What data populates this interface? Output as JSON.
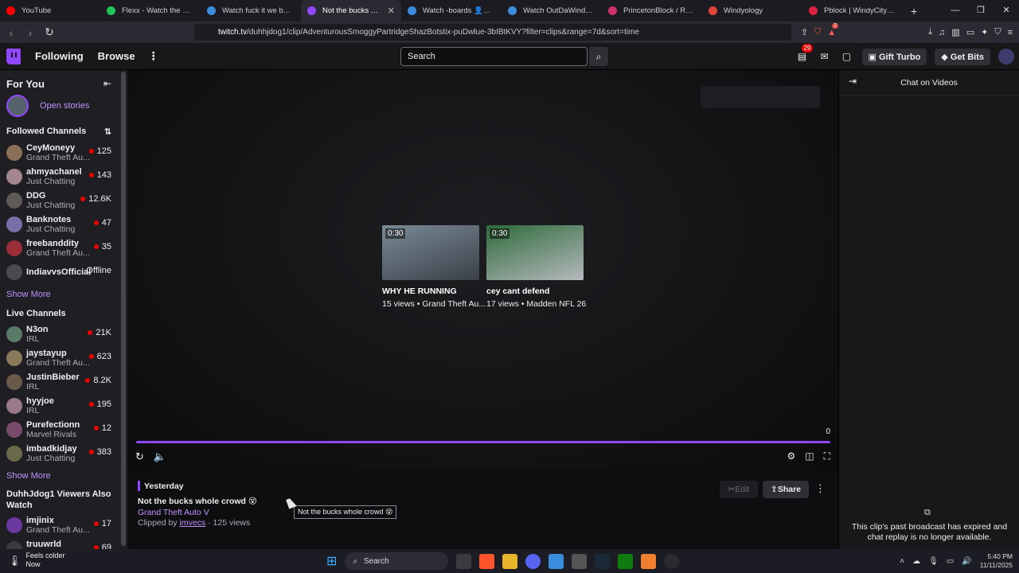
{
  "browser": {
    "tabs": [
      {
        "label": "YouTube",
        "color": "#ff0000",
        "active": false
      },
      {
        "label": "Flexx - Watch the VOD",
        "color": "#21c45a",
        "active": false
      },
      {
        "label": "Watch fuck it we ball-gloc",
        "color": "#3a8dde",
        "active": false
      },
      {
        "label": "Not the bucks whole c",
        "color": "#9147ff",
        "active": true
      },
      {
        "label": "Watch -boards 👤👤 | Str",
        "color": "#3a8dde",
        "active": false
      },
      {
        "label": "Watch OutDaWindow 🍭",
        "color": "#3a8dde",
        "active": false
      },
      {
        "label": "PrincetonBlock / Redzone",
        "color": "#d0306a",
        "active": false
      },
      {
        "label": "Windyology",
        "color": "#e0453a",
        "active": false
      },
      {
        "label": "Pblock | WindyCityRP Wik",
        "color": "#e02040",
        "active": false
      }
    ],
    "url_host": "twitch.tv",
    "url_path": "/duhhjdog1/clip/AdventurousSmoggyPartridgeShazBotstix-puDwlue-3bIBtKVY?filter=clips&range=7d&sort=time",
    "extension_badge": "2"
  },
  "header": {
    "following": "Following",
    "browse": "Browse",
    "search_placeholder": "Search",
    "notifications": "29",
    "gift_turbo": "Gift Turbo",
    "get_bits": "Get Bits"
  },
  "sidebar": {
    "for_you": "For You",
    "open_stories": "Open stories",
    "followed_title": "Followed Channels",
    "followed": [
      {
        "name": "CeyMoneyy",
        "game": "Grand Theft Au...",
        "viewers": "125",
        "color": "#8a6f5a"
      },
      {
        "name": "ahmyachanel",
        "game": "Just Chatting",
        "viewers": "143",
        "color": "#a3868f"
      },
      {
        "name": "DDG",
        "game": "Just Chatting",
        "viewers": "12.6K",
        "color": "#5e5a55"
      },
      {
        "name": "Banknotes",
        "game": "Just Chatting",
        "viewers": "47",
        "color": "#7a6ea8"
      },
      {
        "name": "freebanddity",
        "game": "Grand Theft Au...",
        "viewers": "35",
        "color": "#9a2f3a"
      },
      {
        "name": "IndiavvsOfficial",
        "game": "",
        "viewers": "Offline",
        "color": "#4a4a4f"
      }
    ],
    "show_more_1": "Show More",
    "live_title": "Live Channels",
    "live": [
      {
        "name": "N3on",
        "game": "IRL",
        "viewers": "21K",
        "color": "#5a7a6a"
      },
      {
        "name": "jaystayup",
        "game": "Grand Theft Au...",
        "viewers": "623",
        "color": "#8a7a5a"
      },
      {
        "name": "JustinBieber",
        "game": "IRL",
        "viewers": "8.2K",
        "color": "#6a5a4a"
      },
      {
        "name": "hyyjoe",
        "game": "IRL",
        "viewers": "195",
        "color": "#9a7a8a"
      },
      {
        "name": "Purefectionn",
        "game": "Marvel Rivals",
        "viewers": "12",
        "color": "#7a4a6a"
      },
      {
        "name": "imbadkidjay",
        "game": "Just Chatting",
        "viewers": "383",
        "color": "#6a6a4a"
      }
    ],
    "show_more_2": "Show More",
    "also_watch_title": "DuhhJdog1 Viewers Also Watch",
    "also": [
      {
        "name": "imjinix",
        "game": "Grand Theft Au...",
        "viewers": "17",
        "color": "#6a3aa0"
      },
      {
        "name": "truuwrld",
        "game": "Grand Theft Au...",
        "viewers": "69",
        "color": "#3a3a3f"
      }
    ]
  },
  "player": {
    "recs": [
      {
        "duration": "0:30",
        "title": "WHY HE RUNNING",
        "meta": "15 views • Grand Theft Au...",
        "color1": "#7a8a96",
        "color2": "#3a4048"
      },
      {
        "duration": "0:30",
        "title": "cey cant defend",
        "meta": "17 views • Madden NFL 26",
        "color1": "#2e6a3a",
        "color2": "#b5b9bd"
      }
    ],
    "counter": "0",
    "progress": 1.0
  },
  "clip": {
    "date": "Yesterday",
    "title": "Not the bucks whole crowd 😵",
    "game": "Grand Theft Auto V",
    "clipped_by_prefix": "Clipped by ",
    "clipper": "imvecs",
    "views": " · 125 views",
    "edit": "Edit",
    "share": "Share",
    "tooltip": "Not the bucks whole crowd 😵"
  },
  "chat": {
    "title": "Chat on Videos",
    "message": "This clip's past broadcast has expired and chat replay is no longer available."
  },
  "taskbar": {
    "weather_title": "Feels colder",
    "weather_sub": "Now",
    "search": "Search",
    "time": "5:40 PM",
    "date": "11/11/2025"
  }
}
